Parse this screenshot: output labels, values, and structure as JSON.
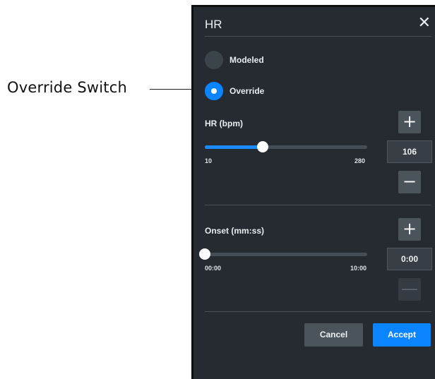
{
  "annotation": {
    "label": "Override Switch"
  },
  "dialog": {
    "title": "HR",
    "close_symbol": "✕",
    "mode": {
      "options": [
        {
          "label": "Modeled",
          "selected": false
        },
        {
          "label": "Override",
          "selected": true
        }
      ]
    },
    "hr": {
      "label": "HR (bpm)",
      "value": "106",
      "min": "10",
      "max": "280",
      "numeric": {
        "min": 10,
        "max": 280,
        "value": 106
      },
      "increment_symbol": "+",
      "decrement_symbol": "−"
    },
    "onset": {
      "label": "Onset (mm:ss)",
      "value": "0:00",
      "min": "00:00",
      "max": "10:00",
      "numeric": {
        "min": 0,
        "max": 600,
        "value": 0
      },
      "increment_symbol": "+",
      "decrement_symbol": "—",
      "decrement_disabled": true
    },
    "buttons": {
      "cancel": "Cancel",
      "accept": "Accept"
    }
  },
  "colors": {
    "panel_bg": "#252b31",
    "accent": "#0a84ff",
    "button_bg": "#4b535b"
  },
  "icons": {
    "close": "close-icon",
    "plus": "plus-icon",
    "minus": "minus-icon"
  }
}
